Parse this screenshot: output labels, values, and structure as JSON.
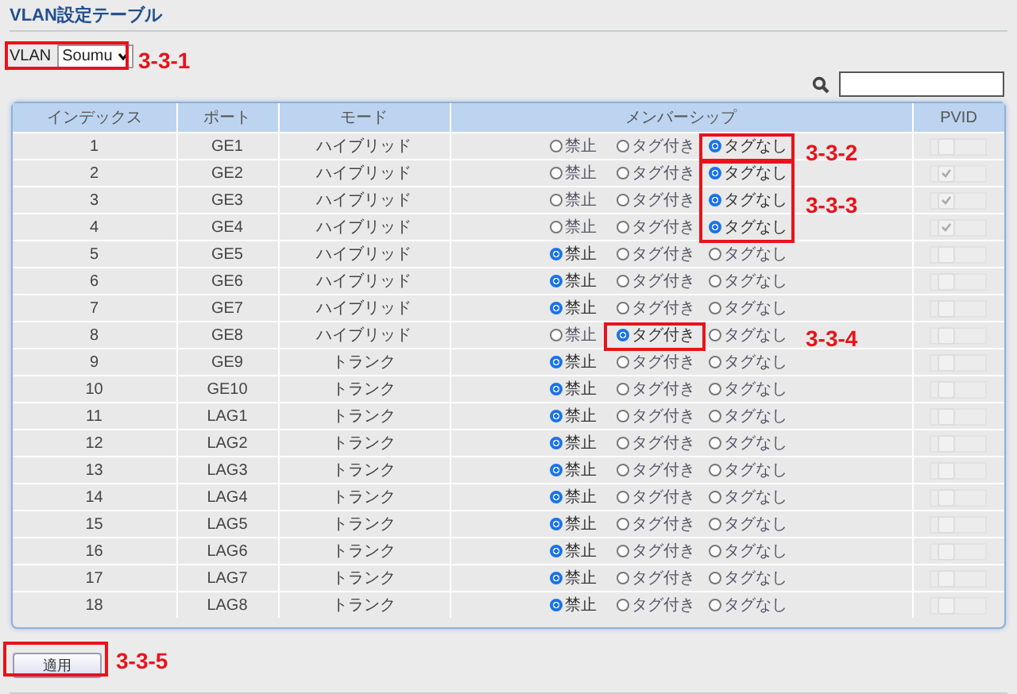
{
  "title": "VLAN設定テーブル",
  "vlan": {
    "label": "VLAN",
    "value": "Soumu"
  },
  "columns": [
    "インデックス",
    "ポート",
    "モード",
    "メンバーシップ",
    "PVID"
  ],
  "rows": [
    {
      "index": "1",
      "port": "GE1",
      "mode": "ハイブリッド",
      "membership": [
        {
          "label": "禁止",
          "selected": false
        },
        {
          "label": "タグ付き",
          "selected": false
        },
        {
          "label": "タグなし",
          "selected": true
        }
      ],
      "pvid_checked": false
    },
    {
      "index": "2",
      "port": "GE2",
      "mode": "ハイブリッド",
      "membership": [
        {
          "label": "禁止",
          "selected": false
        },
        {
          "label": "タグ付き",
          "selected": false
        },
        {
          "label": "タグなし",
          "selected": true
        }
      ],
      "pvid_checked": true
    },
    {
      "index": "3",
      "port": "GE3",
      "mode": "ハイブリッド",
      "membership": [
        {
          "label": "禁止",
          "selected": false
        },
        {
          "label": "タグ付き",
          "selected": false
        },
        {
          "label": "タグなし",
          "selected": true
        }
      ],
      "pvid_checked": true
    },
    {
      "index": "4",
      "port": "GE4",
      "mode": "ハイブリッド",
      "membership": [
        {
          "label": "禁止",
          "selected": false
        },
        {
          "label": "タグ付き",
          "selected": false
        },
        {
          "label": "タグなし",
          "selected": true
        }
      ],
      "pvid_checked": true
    },
    {
      "index": "5",
      "port": "GE5",
      "mode": "ハイブリッド",
      "membership": [
        {
          "label": "禁止",
          "selected": true
        },
        {
          "label": "タグ付き",
          "selected": false
        },
        {
          "label": "タグなし",
          "selected": false
        }
      ],
      "pvid_checked": false
    },
    {
      "index": "6",
      "port": "GE6",
      "mode": "ハイブリッド",
      "membership": [
        {
          "label": "禁止",
          "selected": true
        },
        {
          "label": "タグ付き",
          "selected": false
        },
        {
          "label": "タグなし",
          "selected": false
        }
      ],
      "pvid_checked": false
    },
    {
      "index": "7",
      "port": "GE7",
      "mode": "ハイブリッド",
      "membership": [
        {
          "label": "禁止",
          "selected": true
        },
        {
          "label": "タグ付き",
          "selected": false
        },
        {
          "label": "タグなし",
          "selected": false
        }
      ],
      "pvid_checked": false
    },
    {
      "index": "8",
      "port": "GE8",
      "mode": "ハイブリッド",
      "membership": [
        {
          "label": "禁止",
          "selected": false
        },
        {
          "label": "タグ付き",
          "selected": true
        },
        {
          "label": "タグなし",
          "selected": false
        }
      ],
      "pvid_checked": false
    },
    {
      "index": "9",
      "port": "GE9",
      "mode": "トランク",
      "membership": [
        {
          "label": "禁止",
          "selected": true
        },
        {
          "label": "タグ付き",
          "selected": false
        },
        {
          "label": "タグなし",
          "selected": false
        }
      ],
      "pvid_checked": false
    },
    {
      "index": "10",
      "port": "GE10",
      "mode": "トランク",
      "membership": [
        {
          "label": "禁止",
          "selected": true
        },
        {
          "label": "タグ付き",
          "selected": false
        },
        {
          "label": "タグなし",
          "selected": false
        }
      ],
      "pvid_checked": false
    },
    {
      "index": "11",
      "port": "LAG1",
      "mode": "トランク",
      "membership": [
        {
          "label": "禁止",
          "selected": true
        },
        {
          "label": "タグ付き",
          "selected": false
        },
        {
          "label": "タグなし",
          "selected": false
        }
      ],
      "pvid_checked": false
    },
    {
      "index": "12",
      "port": "LAG2",
      "mode": "トランク",
      "membership": [
        {
          "label": "禁止",
          "selected": true
        },
        {
          "label": "タグ付き",
          "selected": false
        },
        {
          "label": "タグなし",
          "selected": false
        }
      ],
      "pvid_checked": false
    },
    {
      "index": "13",
      "port": "LAG3",
      "mode": "トランク",
      "membership": [
        {
          "label": "禁止",
          "selected": true
        },
        {
          "label": "タグ付き",
          "selected": false
        },
        {
          "label": "タグなし",
          "selected": false
        }
      ],
      "pvid_checked": false
    },
    {
      "index": "14",
      "port": "LAG4",
      "mode": "トランク",
      "membership": [
        {
          "label": "禁止",
          "selected": true
        },
        {
          "label": "タグ付き",
          "selected": false
        },
        {
          "label": "タグなし",
          "selected": false
        }
      ],
      "pvid_checked": false
    },
    {
      "index": "15",
      "port": "LAG5",
      "mode": "トランク",
      "membership": [
        {
          "label": "禁止",
          "selected": true
        },
        {
          "label": "タグ付き",
          "selected": false
        },
        {
          "label": "タグなし",
          "selected": false
        }
      ],
      "pvid_checked": false
    },
    {
      "index": "16",
      "port": "LAG6",
      "mode": "トランク",
      "membership": [
        {
          "label": "禁止",
          "selected": true
        },
        {
          "label": "タグ付き",
          "selected": false
        },
        {
          "label": "タグなし",
          "selected": false
        }
      ],
      "pvid_checked": false
    },
    {
      "index": "17",
      "port": "LAG7",
      "mode": "トランク",
      "membership": [
        {
          "label": "禁止",
          "selected": true
        },
        {
          "label": "タグ付き",
          "selected": false
        },
        {
          "label": "タグなし",
          "selected": false
        }
      ],
      "pvid_checked": false
    },
    {
      "index": "18",
      "port": "LAG8",
      "mode": "トランク",
      "membership": [
        {
          "label": "禁止",
          "selected": true
        },
        {
          "label": "タグ付き",
          "selected": false
        },
        {
          "label": "タグなし",
          "selected": false
        }
      ],
      "pvid_checked": false
    }
  ],
  "apply_button": "適用",
  "annotations": [
    {
      "label": "3-3-1"
    },
    {
      "label": "3-3-2"
    },
    {
      "label": "3-3-3"
    },
    {
      "label": "3-3-4"
    },
    {
      "label": "3-3-5"
    }
  ]
}
